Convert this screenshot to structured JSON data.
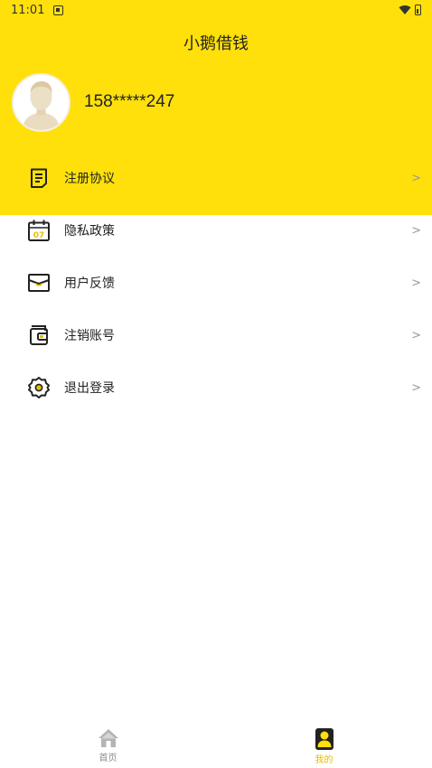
{
  "status_bar": {
    "time": "11:01"
  },
  "header": {
    "title": "小鹅借钱"
  },
  "profile": {
    "phone": "158*****247",
    "avatar_icon": "user-avatar"
  },
  "menu": {
    "chevron": ">",
    "items": [
      {
        "label": "注册协议",
        "icon": "document-icon"
      },
      {
        "label": "隐私政策",
        "icon": "calendar-icon"
      },
      {
        "label": "用户反馈",
        "icon": "mail-icon"
      },
      {
        "label": "注销账号",
        "icon": "wallet-icon"
      },
      {
        "label": "退出登录",
        "icon": "settings-gear-icon"
      }
    ]
  },
  "tab_bar": {
    "tabs": [
      {
        "label": "首页",
        "icon": "home-icon",
        "active": false
      },
      {
        "label": "我的",
        "icon": "user-icon",
        "active": true
      }
    ]
  },
  "colors": {
    "brand": "#FFE00A",
    "accent": "#E8BE00",
    "calendar_day": "07"
  }
}
